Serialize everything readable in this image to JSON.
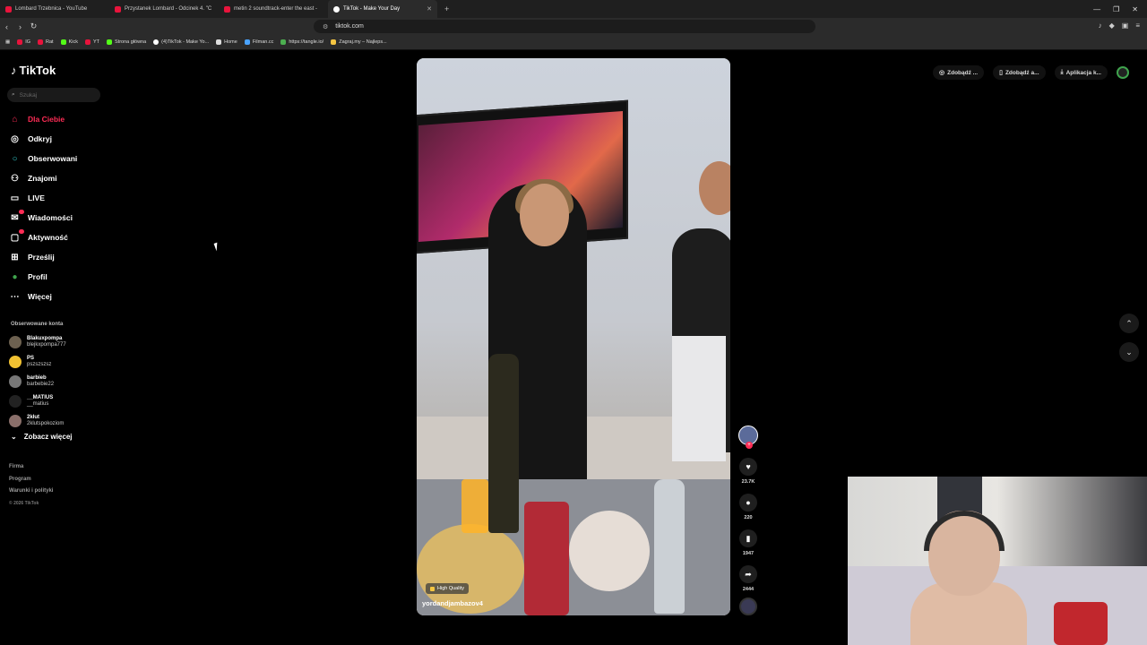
{
  "browser": {
    "tabs": [
      {
        "label": "Lombard Trzebnica - YouTube",
        "active": false
      },
      {
        "label": "Przystanek Lombard - Odcinek 4. \"C",
        "active": false
      },
      {
        "label": "metin 2 soundtrack-enter the east -",
        "active": false
      },
      {
        "label": "TikTok - Make Your Day",
        "active": true
      }
    ],
    "url": "tiktok.com",
    "bookmarks": [
      "IG",
      "Rat",
      "Kick",
      "YT",
      "Strona główna",
      "(4)TikTok - Make Yo...",
      "Home",
      "Filman.cc",
      "https://tangle.io/",
      "Zagraj.my – Najleps..."
    ]
  },
  "sidebar": {
    "logo": "TikTok",
    "search_placeholder": "Szukaj",
    "nav": [
      {
        "label": "Dla Ciebie",
        "icon": "home-icon",
        "active": true
      },
      {
        "label": "Odkryj",
        "icon": "compass-icon"
      },
      {
        "label": "Obserwowani",
        "icon": "following-icon"
      },
      {
        "label": "Znajomi",
        "icon": "friends-icon"
      },
      {
        "label": "LIVE",
        "icon": "live-icon"
      },
      {
        "label": "Wiadomości",
        "icon": "messages-icon"
      },
      {
        "label": "Aktywność",
        "icon": "activity-icon"
      },
      {
        "label": "Prześlij",
        "icon": "upload-icon"
      },
      {
        "label": "Profil",
        "icon": "profile-icon"
      },
      {
        "label": "Więcej",
        "icon": "more-icon"
      }
    ],
    "followed_title": "Obserwowane konta",
    "followed": [
      {
        "name": "Blakuxpompa",
        "handle": "blejkxpompa777"
      },
      {
        "name": "PS",
        "handle": "pszszszsz"
      },
      {
        "name": "barbieb",
        "handle": "barbebie22"
      },
      {
        "name": "__MATIUS",
        "handle": "__matius"
      },
      {
        "name": "2kłut",
        "handle": "2klutspokoziom"
      }
    ],
    "see_more": "Zobacz więcej",
    "footer": [
      "Firma",
      "Program",
      "Warunki i polityki"
    ],
    "copyright": "© 2026 TikTok"
  },
  "video": {
    "badge": "High Quality",
    "username": "yordandjambazov4",
    "likes": "23.7K",
    "comments": "220",
    "saves": "1947",
    "shares": "2444"
  },
  "topbar": {
    "pills": [
      "Zdobądź ...",
      "Zdobądź a...",
      "Aplikacja k..."
    ]
  }
}
